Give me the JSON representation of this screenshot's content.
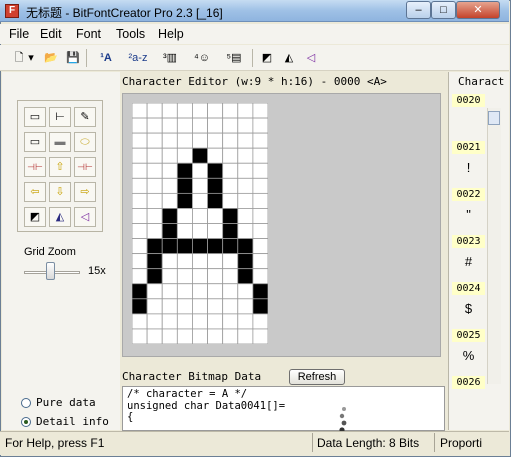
{
  "window": {
    "title": "无标题 - BitFontCreator Pro 2.3 [_16]",
    "app_icon_letter": "F"
  },
  "caption_buttons": {
    "minimize": "–",
    "maximize": "□",
    "close": "✕"
  },
  "menu": [
    "File",
    "Edit",
    "Font",
    "Tools",
    "Help"
  ],
  "toolbar": {
    "buttons": [
      {
        "name": "new-file-icon",
        "glyph": "🗋"
      },
      {
        "name": "dropdown-arrow-icon",
        "glyph": "▾"
      },
      {
        "name": "open-folder-icon",
        "glyph": "📂"
      },
      {
        "name": "save-disk-icon",
        "glyph": "💾"
      },
      {
        "name": "char-size-icon",
        "glyph": "¹A"
      },
      {
        "name": "range-az-icon",
        "glyph": "²a-z"
      },
      {
        "name": "column-icon",
        "glyph": "³▥"
      },
      {
        "name": "emoji-icon",
        "glyph": "⁴☺"
      },
      {
        "name": "import-icon",
        "glyph": "⁵▤"
      },
      {
        "name": "invert-icon",
        "glyph": "◩"
      },
      {
        "name": "mirror-icon",
        "glyph": "◭"
      },
      {
        "name": "eraser-icon",
        "glyph": "◁"
      }
    ]
  },
  "tools": [
    [
      "▭",
      "⊢",
      "✎"
    ],
    [
      "▭",
      "▬",
      "⬭"
    ],
    [
      "⊣⊢",
      "⇧",
      "⊣⊢"
    ],
    [
      "⇦",
      "⇩",
      "⇨"
    ],
    [
      "◩",
      "◭",
      "◁"
    ]
  ],
  "zoom": {
    "label": "Grid Zoom",
    "value": "15x",
    "level": 0.55
  },
  "editor": {
    "title": "Character Editor (w:9 * h:16) - 0000 <A>"
  },
  "glyph": {
    "cols": 9,
    "rows": 16,
    "bitmap": [
      "000000000",
      "000000000",
      "000000000",
      "000010000",
      "000101000",
      "000101000",
      "000101000",
      "001000100",
      "001000100",
      "011111110",
      "010000010",
      "010000010",
      "100000001",
      "100000001",
      "000000000",
      "000000000"
    ]
  },
  "bitmap_data": {
    "title": "Character Bitmap Data",
    "refresh_label": "Refresh",
    "code": "/* character = A */\nunsigned char Data0041[]=\n{"
  },
  "view_mode": {
    "pure": "Pure data",
    "detail": "Detail info",
    "selected": "detail"
  },
  "char_panel": {
    "title": "Charact",
    "items": [
      {
        "code": "0020",
        "glyph": ""
      },
      {
        "code": "0021",
        "glyph": "!"
      },
      {
        "code": "0022",
        "glyph": "\""
      },
      {
        "code": "0023",
        "glyph": "#"
      },
      {
        "code": "0024",
        "glyph": "$"
      },
      {
        "code": "0025",
        "glyph": "%"
      },
      {
        "code": "0026",
        "glyph": ""
      }
    ]
  },
  "status": {
    "help": "For Help, press F1",
    "info": "Data Length: 8 Bits",
    "encoding": "Proporti"
  }
}
